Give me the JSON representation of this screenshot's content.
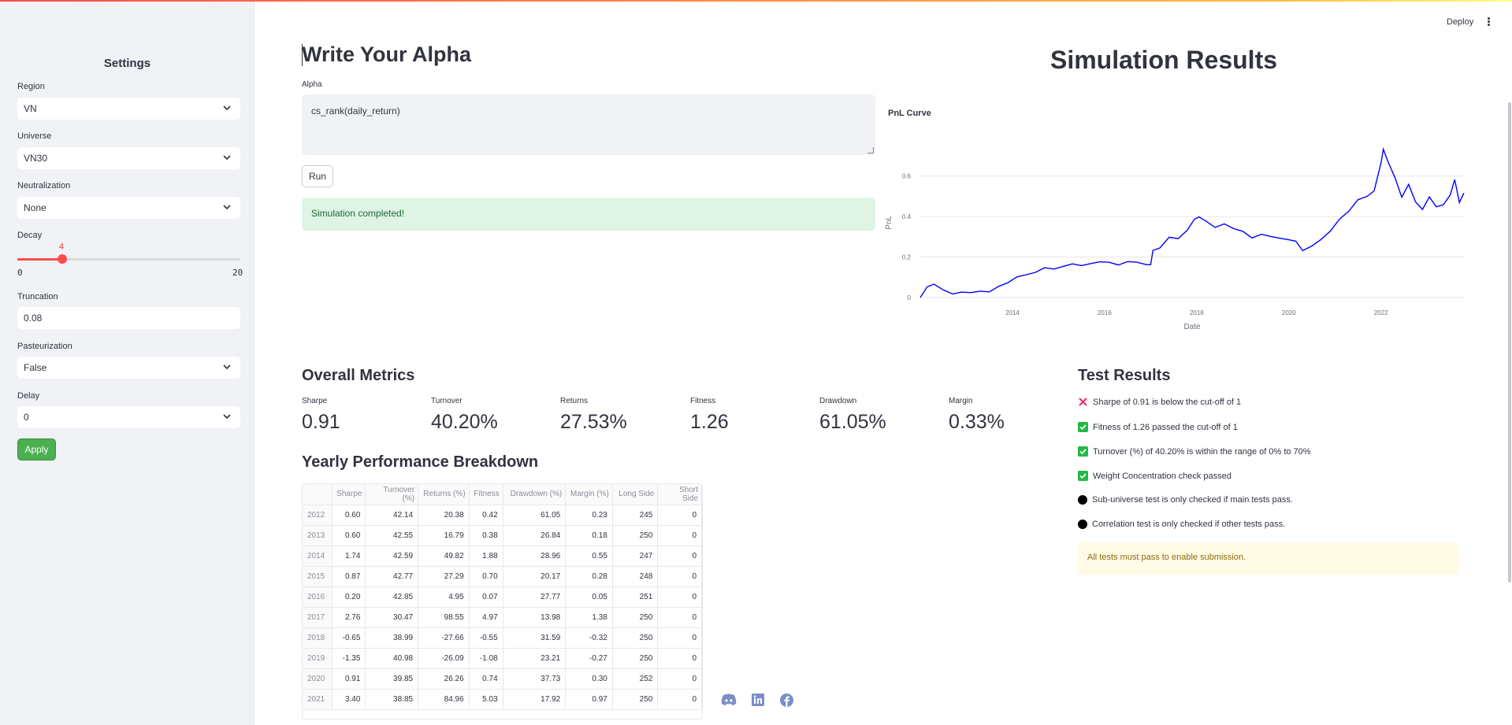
{
  "colors": {
    "accent": "#ff4b4b",
    "apply": "#4caf50",
    "success_bg": "#dff4e5",
    "warn_bg": "#fffbe6",
    "line": "#0000ff"
  },
  "header": {
    "deploy_label": "Deploy",
    "menu_icon": "kebab-icon"
  },
  "sidebar": {
    "title": "Settings",
    "region": {
      "label": "Region",
      "value": "VN"
    },
    "universe": {
      "label": "Universe",
      "value": "VN30"
    },
    "neutralization": {
      "label": "Neutralization",
      "value": "None"
    },
    "decay": {
      "label": "Decay",
      "value": "4",
      "min": "0",
      "max": "20",
      "fraction": 0.2
    },
    "truncation": {
      "label": "Truncation",
      "value": "0.08"
    },
    "pasteurization": {
      "label": "Pasteurization",
      "value": "False"
    },
    "delay": {
      "label": "Delay",
      "value": "0"
    },
    "apply_label": "Apply"
  },
  "alpha": {
    "heading": "Write Your Alpha",
    "label": "Alpha",
    "value": "cs_rank(daily_return)",
    "run_label": "Run",
    "status": "Simulation completed!"
  },
  "simulation": {
    "heading": "Simulation Results",
    "chart_title": "PnL Curve"
  },
  "chart_data": {
    "type": "line",
    "title": "PnL Curve",
    "xlabel": "Date",
    "ylabel": "PnL",
    "x_ticks": [
      "2014",
      "2016",
      "2018",
      "2020",
      "2022"
    ],
    "y_ticks": [
      "0",
      "0.2",
      "0.4",
      "0.6"
    ],
    "ylim": [
      0,
      0.75
    ],
    "xlim": [
      2012.0,
      2023.8
    ],
    "grid": true,
    "series": [
      {
        "x": [
          2012.0,
          2012.15,
          2012.3,
          2012.5,
          2012.7,
          2012.9,
          2013.1,
          2013.3,
          2013.5,
          2013.7,
          2013.9,
          2014.1,
          2014.3,
          2014.5,
          2014.7,
          2014.9,
          2015.1,
          2015.3,
          2015.5,
          2015.7,
          2015.9,
          2016.1,
          2016.3,
          2016.5,
          2016.7,
          2016.9,
          2017.0,
          2017.05,
          2017.2,
          2017.4,
          2017.6,
          2017.8,
          2017.95,
          2018.05,
          2018.2,
          2018.4,
          2018.6,
          2018.8,
          2019.0,
          2019.2,
          2019.4,
          2019.6,
          2019.8,
          2020.0,
          2020.15,
          2020.3,
          2020.5,
          2020.7,
          2020.9,
          2021.1,
          2021.3,
          2021.5,
          2021.7,
          2021.85,
          2022.0,
          2022.05,
          2022.15,
          2022.3,
          2022.45,
          2022.6,
          2022.75,
          2022.9,
          2023.05,
          2023.2,
          2023.35,
          2023.5,
          2023.6,
          2023.7,
          2023.8
        ],
        "y": [
          0.0,
          0.05,
          0.06,
          0.03,
          0.01,
          0.02,
          0.02,
          0.03,
          0.03,
          0.06,
          0.08,
          0.11,
          0.12,
          0.13,
          0.15,
          0.14,
          0.15,
          0.16,
          0.15,
          0.16,
          0.17,
          0.17,
          0.16,
          0.18,
          0.18,
          0.17,
          0.17,
          0.24,
          0.25,
          0.3,
          0.29,
          0.33,
          0.38,
          0.39,
          0.37,
          0.34,
          0.36,
          0.34,
          0.33,
          0.3,
          0.32,
          0.31,
          0.3,
          0.29,
          0.28,
          0.23,
          0.25,
          0.28,
          0.32,
          0.38,
          0.42,
          0.48,
          0.5,
          0.53,
          0.67,
          0.74,
          0.68,
          0.6,
          0.5,
          0.56,
          0.47,
          0.43,
          0.49,
          0.44,
          0.45,
          0.5,
          0.58,
          0.47,
          0.52
        ]
      }
    ]
  },
  "metrics": {
    "heading": "Overall Metrics",
    "items": [
      {
        "label": "Sharpe",
        "value": "0.91"
      },
      {
        "label": "Turnover",
        "value": "40.20%"
      },
      {
        "label": "Returns",
        "value": "27.53%"
      },
      {
        "label": "Fitness",
        "value": "1.26"
      },
      {
        "label": "Drawdown",
        "value": "61.05%"
      },
      {
        "label": "Margin",
        "value": "0.33%"
      }
    ]
  },
  "yearly": {
    "heading": "Yearly Performance Breakdown",
    "columns": [
      "",
      "Sharpe",
      "Turnover (%)",
      "Returns (%)",
      "Fitness",
      "Drawdown (%)",
      "Margin (%)",
      "Long Side",
      "Short Side"
    ],
    "rows": [
      [
        "2012",
        "0.60",
        "42.14",
        "20.38",
        "0.42",
        "61.05",
        "0.23",
        "245",
        "0"
      ],
      [
        "2013",
        "0.60",
        "42.55",
        "16.79",
        "0.38",
        "26.84",
        "0.18",
        "250",
        "0"
      ],
      [
        "2014",
        "1.74",
        "42.59",
        "49.82",
        "1.88",
        "28.96",
        "0.55",
        "247",
        "0"
      ],
      [
        "2015",
        "0.87",
        "42.77",
        "27.29",
        "0.70",
        "20.17",
        "0.28",
        "248",
        "0"
      ],
      [
        "2016",
        "0.20",
        "42.85",
        "4.95",
        "0.07",
        "27.77",
        "0.05",
        "251",
        "0"
      ],
      [
        "2017",
        "2.76",
        "30.47",
        "98.55",
        "4.97",
        "13.98",
        "1.38",
        "250",
        "0"
      ],
      [
        "2018",
        "-0.65",
        "38.99",
        "-27.66",
        "-0.55",
        "31.59",
        "-0.32",
        "250",
        "0"
      ],
      [
        "2019",
        "-1.35",
        "40.98",
        "-26.09",
        "-1.08",
        "23.21",
        "-0.27",
        "250",
        "0"
      ],
      [
        "2020",
        "0.91",
        "39.85",
        "26.26",
        "0.74",
        "37.73",
        "0.30",
        "252",
        "0"
      ],
      [
        "2021",
        "3.40",
        "38.85",
        "84.96",
        "5.03",
        "17.92",
        "0.97",
        "250",
        "0"
      ]
    ]
  },
  "tests": {
    "heading": "Test Results",
    "items": [
      {
        "status": "fail",
        "icon": "cross-icon",
        "text": "Sharpe of 0.91 is below the cut-off of 1"
      },
      {
        "status": "pass",
        "icon": "check-icon",
        "text": "Fitness of 1.26 passed the cut-off of 1"
      },
      {
        "status": "pass",
        "icon": "check-icon",
        "text": "Turnover (%) of 40.20% is within the range of 0% to 70%"
      },
      {
        "status": "pass",
        "icon": "check-icon",
        "text": "Weight Concentration check passed"
      },
      {
        "status": "pending",
        "icon": "dot-icon",
        "text": "Sub-universe test is only checked if main tests pass."
      },
      {
        "status": "pending",
        "icon": "dot-icon",
        "text": "Correlation test is only checked if other tests pass."
      }
    ],
    "warning": "All tests must pass to enable submission."
  },
  "socials": [
    "discord-icon",
    "linkedin-icon",
    "facebook-icon"
  ]
}
